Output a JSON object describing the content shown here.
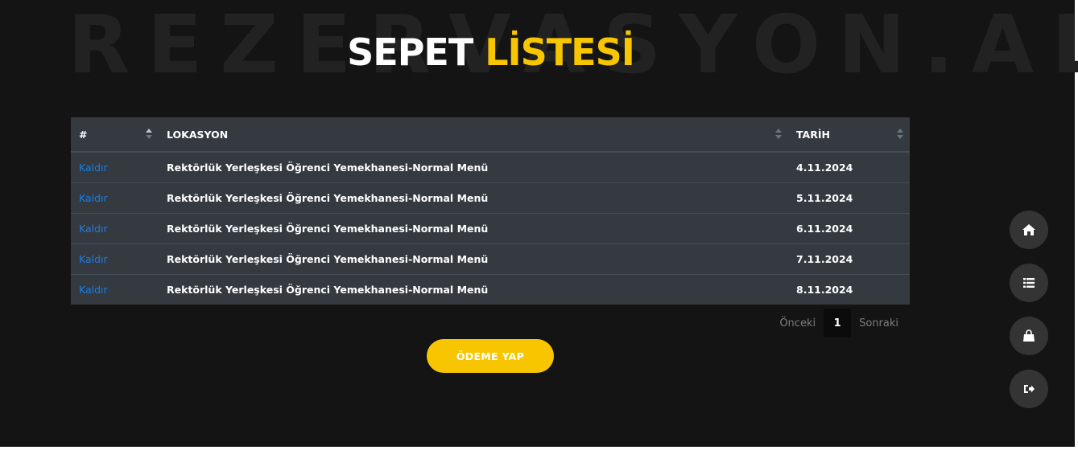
{
  "header": {
    "watermark": "REZERVASYON.AL",
    "title_white": "SEPET ",
    "title_yellow": "LİSTESİ"
  },
  "table": {
    "columns": [
      "#",
      "LOKASYON",
      "TARİH"
    ],
    "rows": [
      {
        "action": "Kaldır",
        "location": "Rektörlük Yerleşkesi Öğrenci Yemekhanesi-Normal Menü",
        "date": "4.11.2024"
      },
      {
        "action": "Kaldır",
        "location": "Rektörlük Yerleşkesi Öğrenci Yemekhanesi-Normal Menü",
        "date": "5.11.2024"
      },
      {
        "action": "Kaldır",
        "location": "Rektörlük Yerleşkesi Öğrenci Yemekhanesi-Normal Menü",
        "date": "6.11.2024"
      },
      {
        "action": "Kaldır",
        "location": "Rektörlük Yerleşkesi Öğrenci Yemekhanesi-Normal Menü",
        "date": "7.11.2024"
      },
      {
        "action": "Kaldır",
        "location": "Rektörlük Yerleşkesi Öğrenci Yemekhanesi-Normal Menü",
        "date": "8.11.2024"
      }
    ]
  },
  "pagination": {
    "prev_label": "Önceki",
    "current_page": "1",
    "next_label": "Sonraki"
  },
  "actions": {
    "pay_label": "ÖDEME YAP"
  },
  "side_nav": {
    "icons": [
      "home-icon",
      "list-icon",
      "shopping-bag-icon",
      "sign-out-icon"
    ]
  },
  "colors": {
    "background": "#141414",
    "accent": "#f7c600",
    "table_bg": "#343a40",
    "link": "#1a7de6",
    "fab_bg": "#343434"
  }
}
